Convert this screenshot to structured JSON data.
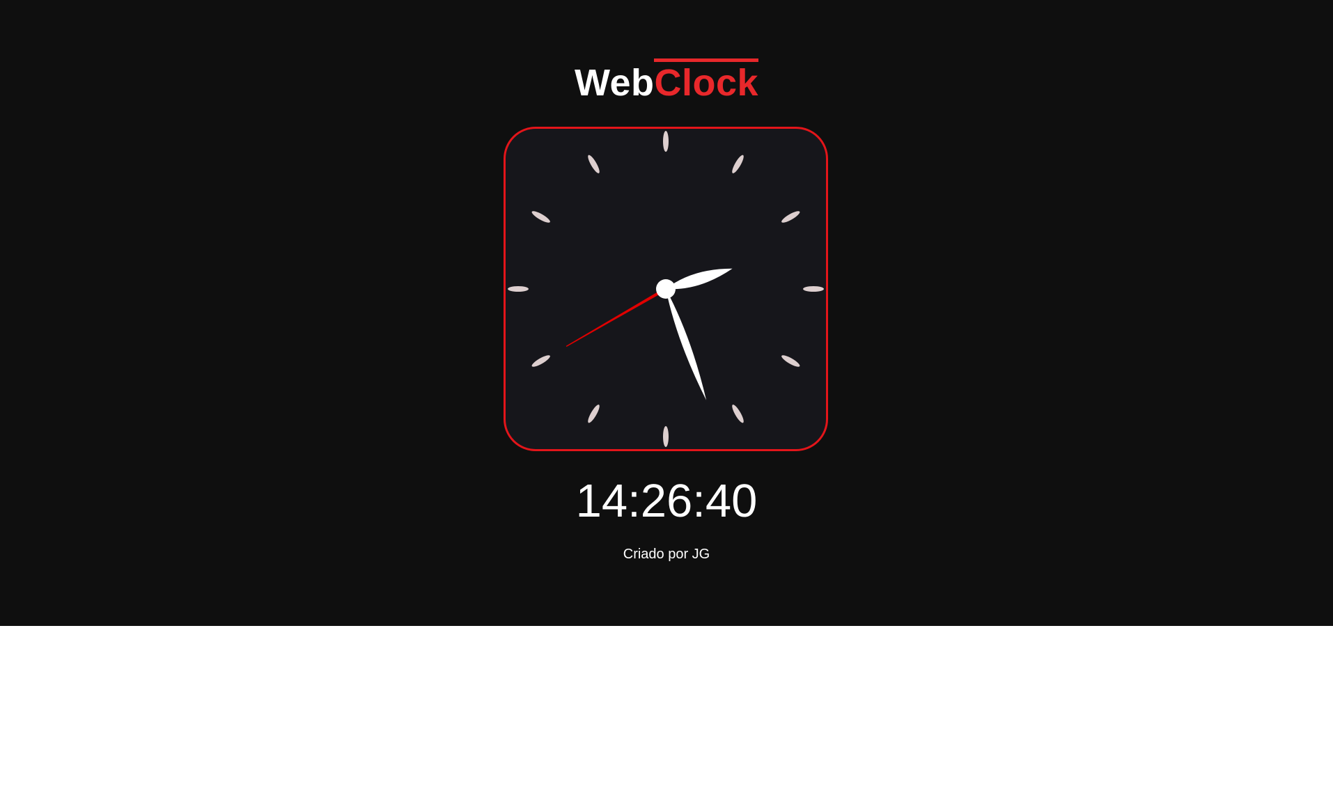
{
  "header": {
    "title_part1": "Web",
    "title_part2": "Clock"
  },
  "clock": {
    "hours": 14,
    "minutes": 26,
    "seconds": 40,
    "digital_time": "14:26:40"
  },
  "footer": {
    "credit": "Criado por JG"
  },
  "colors": {
    "background": "#0f0f0f",
    "accent": "#e3151a",
    "face": "#16161b",
    "markers": "#ddcfcf",
    "hands": "#ffffff",
    "second_hand": "#e00000"
  }
}
